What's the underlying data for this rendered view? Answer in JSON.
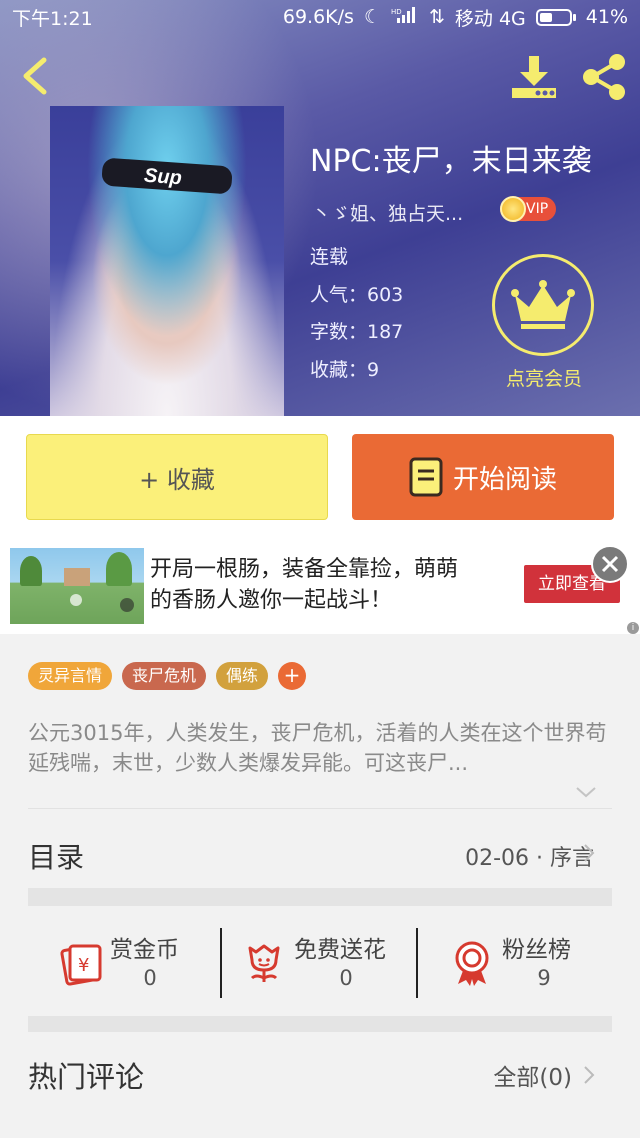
{
  "status_bar": {
    "time": "下午1:21",
    "speed": "69.6K/s",
    "carrier": "移动 4G",
    "battery": "41%"
  },
  "book": {
    "title": "NPC:丧尸，末日来袭",
    "author": "丶ゞ姐、独占天...",
    "vip_label": "VIP",
    "stats": [
      "连载",
      "人气：603",
      "字数：187",
      "收藏：9"
    ],
    "member_label": "点亮会员",
    "cover_text": "Sup"
  },
  "actions": {
    "favorite": "+ 收藏",
    "read": "开始阅读"
  },
  "ad": {
    "line1": "开局一根肠，装备全靠捡，萌萌",
    "line2": "的香肠人邀你一起战斗！",
    "cta": "立即查看",
    "info": "i"
  },
  "tags": [
    {
      "label": "灵异言情",
      "color": "#f0a63a"
    },
    {
      "label": "丧尸危机",
      "color": "#c9684e"
    },
    {
      "label": "偶练",
      "color": "#d2a13d"
    }
  ],
  "tag_add": "+",
  "synopsis": "公元3015年，人类发生，丧尸危机，活着的人类在这个世界苟延残喘，末世，少数人类爆发异能。可这丧尸...",
  "catalog": {
    "label": "目录",
    "latest": "02-06 · 序言"
  },
  "rewards": [
    {
      "name": "赏金币",
      "count": "0"
    },
    {
      "name": "免费送花",
      "count": "0"
    },
    {
      "name": "粉丝榜",
      "count": "9"
    }
  ],
  "comments": {
    "label": "热门评论",
    "all": "全部(0)"
  },
  "colors": {
    "accent_yellow": "#f5ec6e",
    "read_button": "#ea6a35",
    "favorite_button": "#fbf07a",
    "icon_red": "#d63a2f"
  }
}
